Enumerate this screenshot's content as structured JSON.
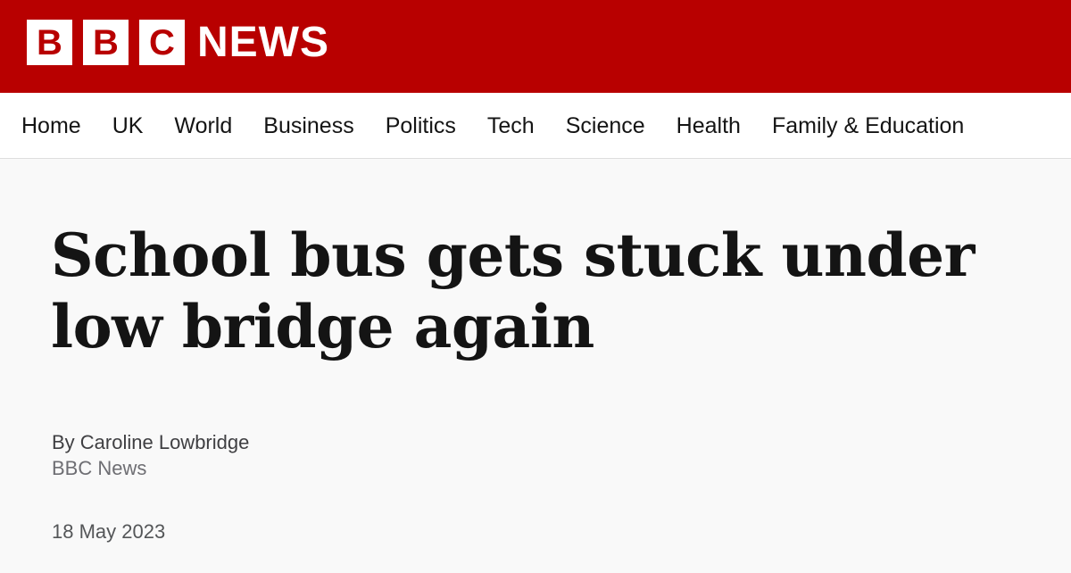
{
  "header": {
    "logo_letters": [
      "B",
      "B",
      "C"
    ],
    "logo_text": "NEWS",
    "brand_color": "#b80000"
  },
  "nav": {
    "items": [
      "Home",
      "UK",
      "World",
      "Business",
      "Politics",
      "Tech",
      "Science",
      "Health",
      "Family & Education"
    ]
  },
  "article": {
    "headline": "School bus gets stuck under low bridge again",
    "author": "By Caroline Lowbridge",
    "organisation": "BBC News",
    "date": "18 May 2023"
  }
}
